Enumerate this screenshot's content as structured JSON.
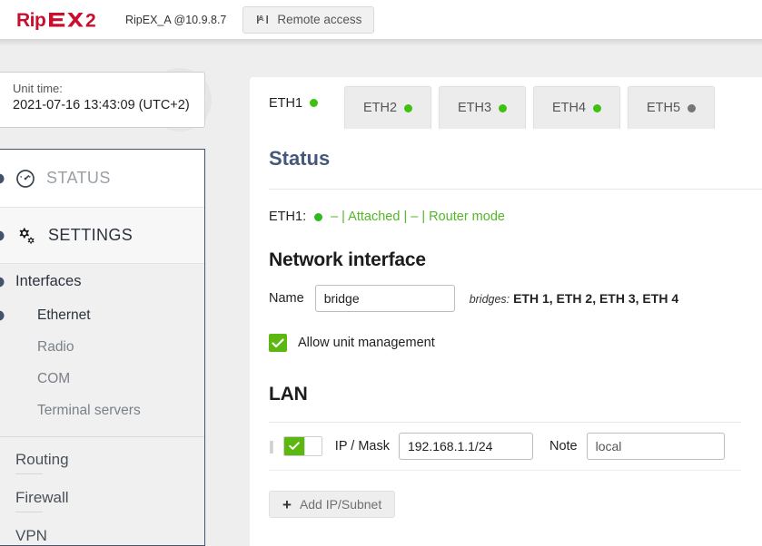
{
  "header": {
    "logo_text": "RipEX2",
    "unit_label": "RipEX_A @10.9.8.7",
    "remote_access_label": "Remote access",
    "remote_access_icon": "antenna-signal-icon",
    "brand_color": "#c8102e"
  },
  "unit_time": {
    "label": "Unit time:",
    "value": "2021-07-16 13:43:09 (UTC+2)"
  },
  "sidebar": {
    "status_label": "STATUS",
    "status_icon": "gauge-icon",
    "settings_label": "SETTINGS",
    "settings_icon": "gears-icon",
    "interfaces_label": "Interfaces",
    "sub_items": [
      {
        "label": "Ethernet",
        "active": true
      },
      {
        "label": "Radio",
        "active": false
      },
      {
        "label": "COM",
        "active": false
      },
      {
        "label": "Terminal servers",
        "active": false
      }
    ],
    "bottom_items": [
      {
        "label": "Routing"
      },
      {
        "label": "Firewall"
      },
      {
        "label": "VPN"
      }
    ]
  },
  "tabs": [
    {
      "label": "ETH1",
      "dot_color": "#3fc20f",
      "active": true
    },
    {
      "label": "ETH2",
      "dot_color": "#3fc20f",
      "active": false
    },
    {
      "label": "ETH3",
      "dot_color": "#3fc20f",
      "active": false
    },
    {
      "label": "ETH4",
      "dot_color": "#3fc20f",
      "active": false
    },
    {
      "label": "ETH5",
      "dot_color": "#767676",
      "active": false
    }
  ],
  "main": {
    "status_heading": "Status",
    "status_row": {
      "name": "ETH1:",
      "dot_color": "#2fbb20",
      "detail": "– | Attached | – | Router mode",
      "detail_color": "#52b827"
    },
    "network_interface": {
      "heading": "Network interface",
      "name_label": "Name",
      "name_value": "bridge",
      "bridges_label": "bridges:",
      "bridges_value": "ETH 1, ETH 2, ETH 3, ETH 4"
    },
    "allow_unit_management": {
      "label": "Allow unit management",
      "checked": true,
      "check_color": "#5cb811"
    },
    "lan": {
      "heading": "LAN",
      "rows": [
        {
          "enabled": true,
          "ip_mask_label": "IP / Mask",
          "ip_mask_value": "192.168.1.1/24",
          "note_label": "Note",
          "note_value": "local"
        }
      ],
      "add_button_label": "Add IP/Subnet",
      "add_button_icon": "plus-icon"
    }
  }
}
